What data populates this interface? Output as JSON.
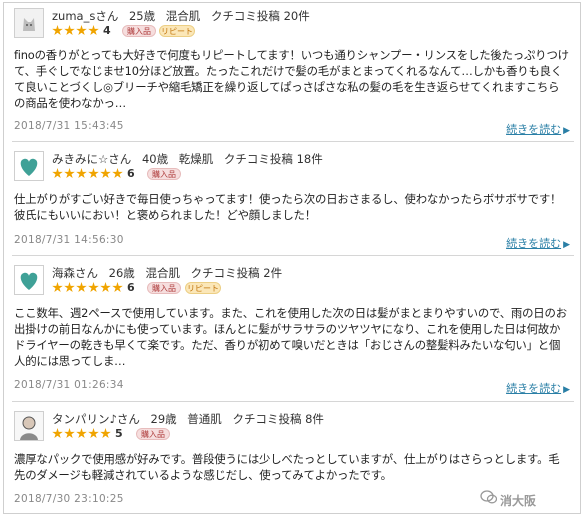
{
  "reviews": [
    {
      "user": "zuma_sさん",
      "age": "25歳",
      "skin": "混合肌",
      "posts": "クチコミ投稿 20件",
      "rating": "4",
      "badges": [
        "購入品",
        "リピート"
      ],
      "text": "finoの香りがとっても大好きで何度もリピートしてます！いつも通りシャンプー・リンスをした後たっぷりつけて、手ぐしでなじませ10分ほど放置。たったこれだけで髪の毛がまとまってくれるなんて…しかも香りも良くて良いことづくし◎ブリーチや縮毛矯正を繰り返してぱっさぱさな私の髪の毛を生き返らせてくれますこちらの商品を使わなかっ…",
      "date": "2018/7/31 15:43:45",
      "more": "続きを読む",
      "avatar": "cat-avatar-icon"
    },
    {
      "user": "みきみに☆さん",
      "age": "40歳",
      "skin": "乾燥肌",
      "posts": "クチコミ投稿 18件",
      "rating": "6",
      "badges": [
        "購入品"
      ],
      "text": "仕上がりがすごい好きで毎日使っちゃってます！使ったら次の日おさまるし、使わなかったらボサボサです！彼氏にもいいにおい！と褒められました！どや顔しました！",
      "date": "2018/7/31 14:56:30",
      "more": "続きを読む",
      "avatar": "heart-avatar-icon"
    },
    {
      "user": "海森さん",
      "age": "26歳",
      "skin": "混合肌",
      "posts": "クチコミ投稿 2件",
      "rating": "6",
      "badges": [
        "購入品",
        "リピート"
      ],
      "text": "ここ数年、週2ペースで使用しています。また、これを使用した次の日は髪がまとまりやすいので、雨の日のお出掛けの前日なんかにも使っています。ほんとに髪がサラサラのツヤツヤになり、これを使用した日は何故かドライヤーの乾きも早くて楽です。ただ、香りが初めて嗅いだときは「おじさんの整髪料みたいな匂い」と個人的には思ってしま…",
      "date": "2018/7/31 01:26:34",
      "more": "続きを読む",
      "avatar": "heart-avatar-icon"
    },
    {
      "user": "タンパリン♪さん",
      "age": "29歳",
      "skin": "普通肌",
      "posts": "クチコミ投稿 8件",
      "rating": "5",
      "badges": [
        "購入品"
      ],
      "text": "濃厚なパックで使用感が好みです。普段使うには少しべたっとしていますが、仕上がりはさらっとします。毛先のダメージも軽減されているような感じだし、使ってみてよかったです。",
      "date": "2018/7/30 23:10:25",
      "more": "",
      "avatar": "person-avatar-icon"
    }
  ],
  "watermark": "消大阪"
}
